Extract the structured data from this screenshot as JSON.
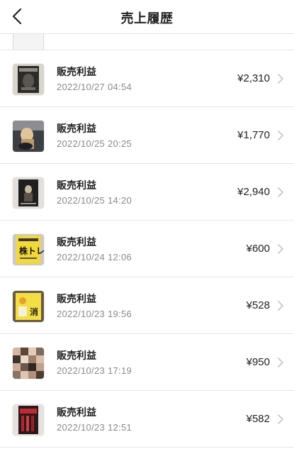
{
  "header": {
    "title": "売上履歴",
    "back_icon": "chevron-left-icon"
  },
  "colors": {
    "divider": "#e6e6e6",
    "date_text": "#8a8a8a",
    "chevron": "#c4c4c4"
  },
  "rows": [
    {
      "label": "販売利益",
      "date": "2022/10/27 04:54",
      "amount": "¥2,310",
      "thumbnail": "dark-book-cover"
    },
    {
      "label": "販売利益",
      "date": "2022/10/25 20:25",
      "amount": "¥1,770",
      "thumbnail": "figure-photo"
    },
    {
      "label": "販売利益",
      "date": "2022/10/25 14:20",
      "amount": "¥2,940",
      "thumbnail": "dvd-case"
    },
    {
      "label": "販売利益",
      "date": "2022/10/24 12:06",
      "amount": "¥600",
      "thumbnail": "yellow-book-cover",
      "cover_text": "株トレ"
    },
    {
      "label": "販売利益",
      "date": "2022/10/23 19:56",
      "amount": "¥528",
      "thumbnail": "yellow-book-cover",
      "cover_text": "消"
    },
    {
      "label": "販売利益",
      "date": "2022/10/23 17:19",
      "amount": "¥950",
      "thumbnail": "photo-collage"
    },
    {
      "label": "販売利益",
      "date": "2022/10/23 12:51",
      "amount": "¥582",
      "thumbnail": "red-book-cover"
    }
  ]
}
